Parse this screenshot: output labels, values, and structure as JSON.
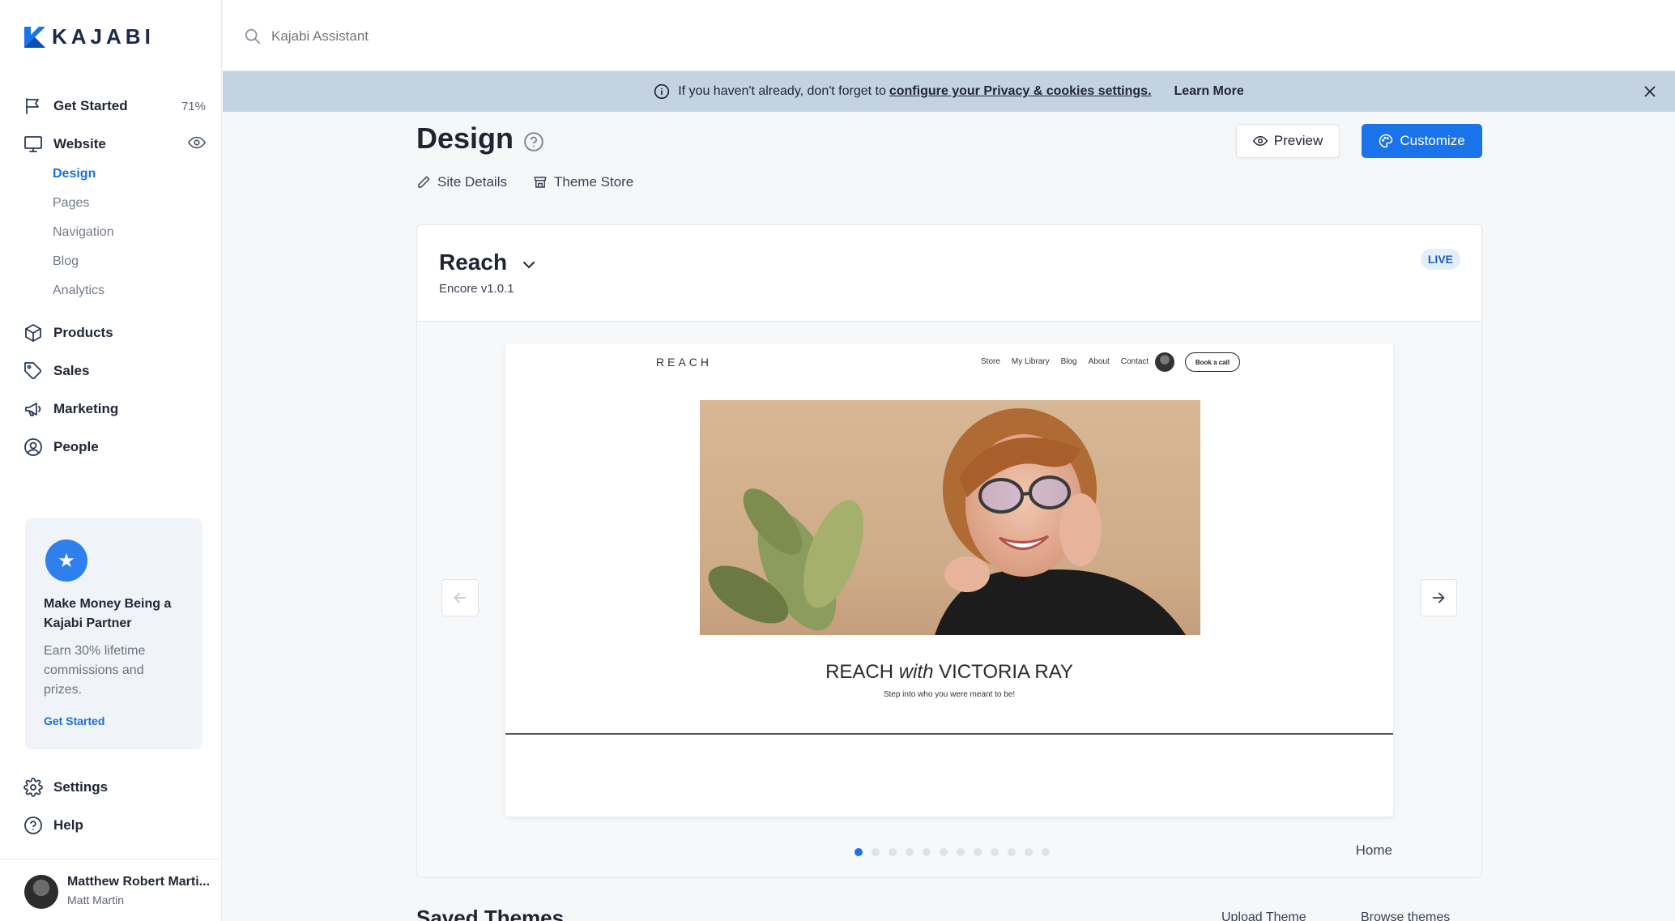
{
  "app": {
    "brand": "KAJABI"
  },
  "search": {
    "placeholder": "Kajabi Assistant"
  },
  "sidebar": {
    "get_started": {
      "label": "Get Started",
      "progress": "71%"
    },
    "website": {
      "label": "Website"
    },
    "website_sub": [
      "Design",
      "Pages",
      "Navigation",
      "Blog",
      "Analytics"
    ],
    "products": "Products",
    "sales": "Sales",
    "marketing": "Marketing",
    "people": "People",
    "settings": "Settings",
    "help": "Help"
  },
  "partner": {
    "title": "Make Money Being a Kajabi Partner",
    "desc": "Earn 30% lifetime commissions and prizes.",
    "cta": "Get Started"
  },
  "user": {
    "name": "Matthew Robert Marti...",
    "handle": "Matt Martin"
  },
  "banner": {
    "text": "If you haven't already, don't forget to",
    "link": "configure your Privacy & cookies settings.",
    "learn_more": "Learn More"
  },
  "page": {
    "title": "Design",
    "preview_label": "Preview",
    "customize_label": "Customize",
    "site_details": "Site Details",
    "theme_store": "Theme Store"
  },
  "theme": {
    "name": "Reach",
    "version": "Encore v1.0.1",
    "status": "LIVE",
    "page_label": "Home",
    "slide_count": 12,
    "active_slide": 1
  },
  "preview": {
    "brand": "REACH",
    "nav": [
      "Store",
      "My Library",
      "Blog",
      "About",
      "Contact"
    ],
    "cta": "Book a call",
    "headline_a": "REACH",
    "headline_em": "with",
    "headline_b": "VICTORIA RAY",
    "tagline": "Step into who you were meant to be!"
  },
  "saved": {
    "title": "Saved Themes",
    "upload": "Upload Theme",
    "browse": "Browse themes"
  },
  "colors": {
    "accent": "#1a73e8",
    "banner": "#c4d3e0",
    "live_badge_text": "#1a5fc7"
  }
}
